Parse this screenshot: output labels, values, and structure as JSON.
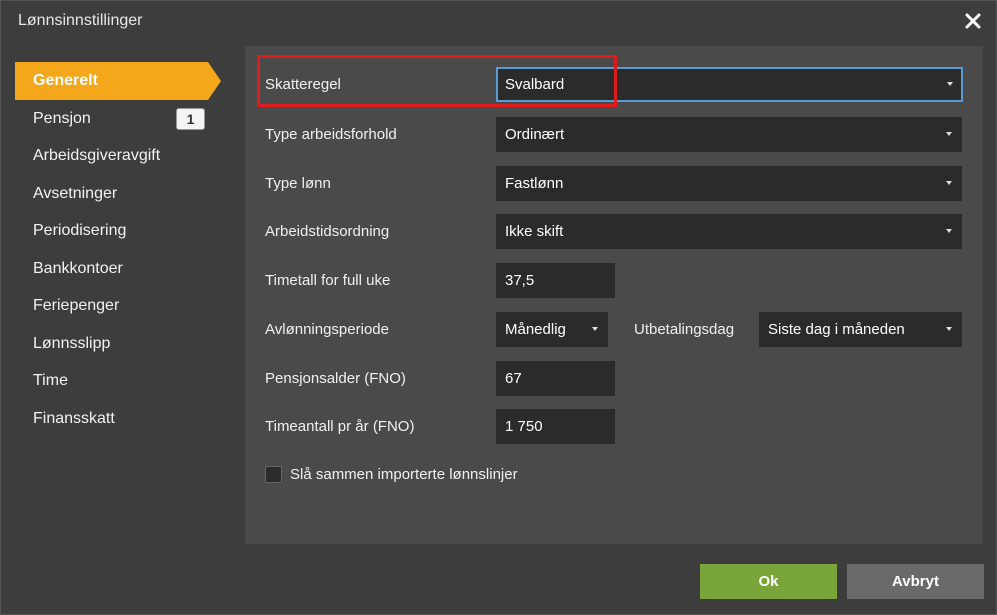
{
  "dialog": {
    "title": "Lønnsinnstillinger",
    "close_icon": "close-icon"
  },
  "sidebar": {
    "items": [
      {
        "label": "Generelt",
        "active": true
      },
      {
        "label": "Pensjon",
        "badge": "1"
      },
      {
        "label": "Arbeidsgiveravgift"
      },
      {
        "label": "Avsetninger"
      },
      {
        "label": "Periodisering"
      },
      {
        "label": "Bankkontoer"
      },
      {
        "label": "Feriepenger"
      },
      {
        "label": "Lønnsslipp"
      },
      {
        "label": "Time"
      },
      {
        "label": "Finansskatt"
      }
    ]
  },
  "form": {
    "skatteregel": {
      "label": "Skatteregel",
      "value": "Svalbard"
    },
    "type_arbeidsforhold": {
      "label": "Type arbeidsforhold",
      "value": "Ordinært"
    },
    "type_lonn": {
      "label": "Type lønn",
      "value": "Fastlønn"
    },
    "arbeidstidsordning": {
      "label": "Arbeidstidsordning",
      "value": "Ikke skift"
    },
    "timetall_full_uke": {
      "label": "Timetall for full uke",
      "value": "37,5"
    },
    "avlonningsperiode": {
      "label": "Avlønningsperiode",
      "value": "Månedlig"
    },
    "utbetalingsdag": {
      "label": "Utbetalingsdag",
      "value": "Siste dag i måneden"
    },
    "pensjonsalder": {
      "label": "Pensjonsalder (FNO)",
      "value": "67"
    },
    "timeantall_pr_ar": {
      "label": "Timeantall pr år (FNO)",
      "value": "1 750"
    },
    "sla_sammen": {
      "label": "Slå sammen importerte lønnslinjer",
      "checked": false
    }
  },
  "footer": {
    "ok_label": "Ok",
    "cancel_label": "Avbryt"
  },
  "colors": {
    "accent": "#f4a71a",
    "ok": "#7aa53b",
    "highlight": "#e01b1b"
  }
}
